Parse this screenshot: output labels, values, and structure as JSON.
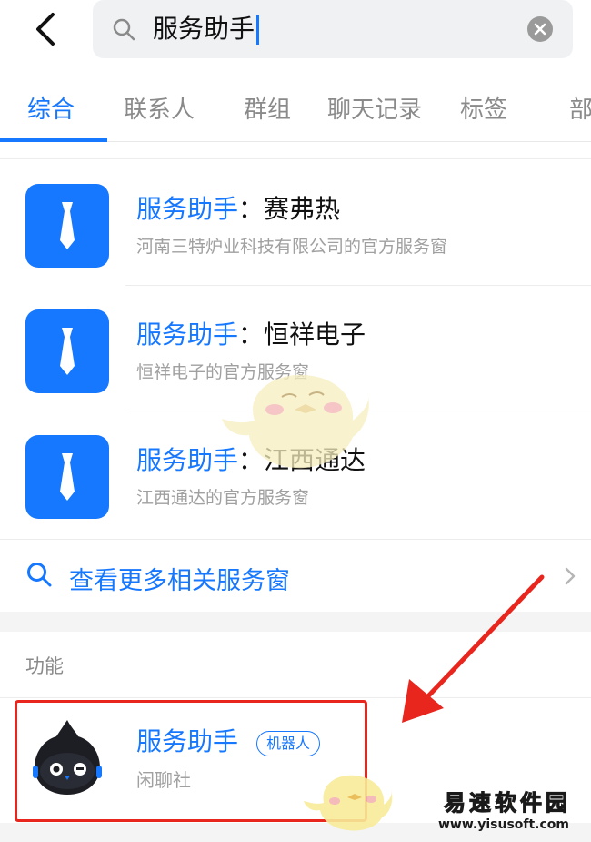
{
  "search": {
    "query": "服务助手"
  },
  "tabs": [
    {
      "label": "综合",
      "active": true
    },
    {
      "label": "联系人"
    },
    {
      "label": "群组"
    },
    {
      "label": "聊天记录"
    },
    {
      "label": "标签"
    },
    {
      "label": "部"
    }
  ],
  "service_windows": [
    {
      "keyword": "服务助手",
      "colon": "：",
      "name": "赛弗热",
      "subtitle": "河南三特炉业科技有限公司的官方服务窗"
    },
    {
      "keyword": "服务助手",
      "colon": "：",
      "name": "恒祥电子",
      "subtitle": "恒祥电子的官方服务窗"
    },
    {
      "keyword": "服务助手",
      "colon": "：",
      "name": "江西通达",
      "subtitle": "江西通达的官方服务窗"
    }
  ],
  "more_link": {
    "label": "查看更多相关服务窗"
  },
  "functions": {
    "section_label": "功能",
    "bot": {
      "title": "服务助手",
      "badge": "机器人",
      "subtitle": "闲聊社"
    }
  },
  "watermark": {
    "brand": "易速软件园",
    "url": "www.yisusoft.com"
  },
  "colors": {
    "accent": "#1677ff",
    "highlight": "#e8261d",
    "arrow": "#e8261d",
    "watermark_gold": "#f2b600"
  }
}
